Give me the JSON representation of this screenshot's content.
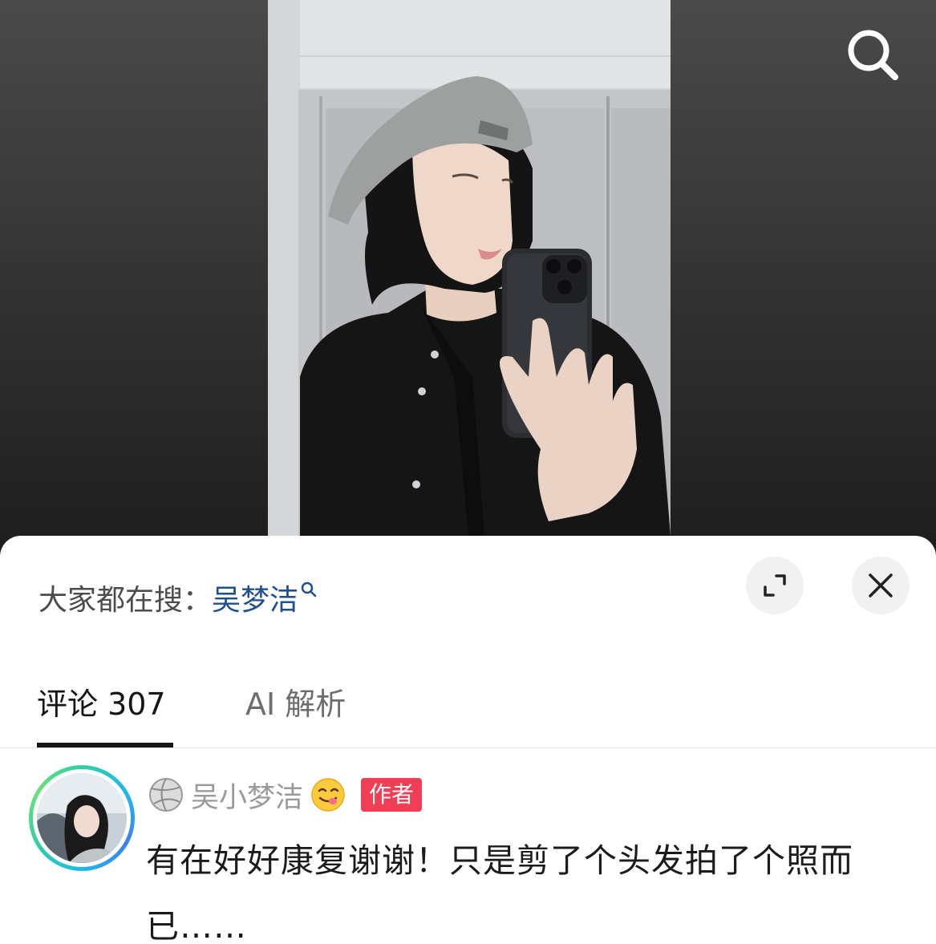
{
  "hot_search": {
    "prefix": "大家都在搜：",
    "keyword": "吴梦洁"
  },
  "tabs": [
    {
      "label": "评论 307",
      "active": true
    },
    {
      "label": "AI 解析",
      "active": false
    }
  ],
  "comment": {
    "username": "吴小梦洁",
    "badge": "作者",
    "text": "有在好好康复谢谢！只是剪了个头发拍了个照而已……"
  },
  "icons": {
    "top_right": "search-icon",
    "expand": "expand-icon",
    "close": "close-icon",
    "user_badge": "volleyball-icon",
    "user_emoji": "yum-emoji-icon"
  },
  "colors": {
    "keyword_link": "#1f4f8f",
    "author_badge": "#f03e55",
    "avatar_ring_start": "#2fd0a5",
    "avatar_ring_end": "#3c7ff2"
  }
}
